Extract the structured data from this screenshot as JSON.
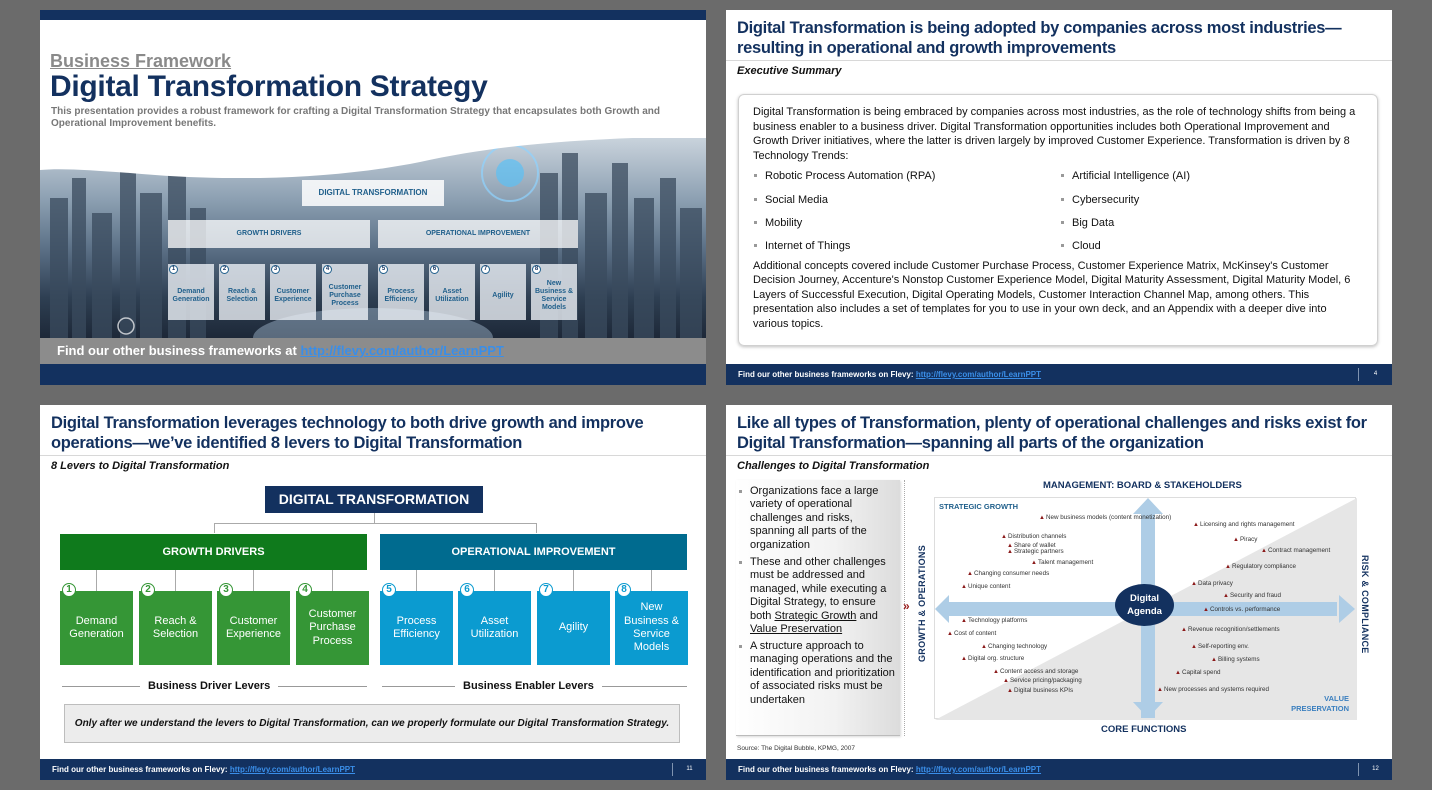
{
  "slides": {
    "cover": {
      "kicker": "Business Framework",
      "title": "Digital Transformation Strategy",
      "description": "This presentation provides a robust framework for crafting a Digital Transformation Strategy that encapsulates both Growth and Operational Improvement benefits.",
      "diagram": {
        "root": "DIGITAL TRANSFORMATION",
        "groups": [
          "GROWTH DRIVERS",
          "OPERATIONAL IMPROVEMENT"
        ],
        "levers": [
          {
            "num": "1",
            "label": "Demand Generation"
          },
          {
            "num": "2",
            "label": "Reach & Selection"
          },
          {
            "num": "3",
            "label": "Customer Experience"
          },
          {
            "num": "4",
            "label": "Customer Purchase Process"
          },
          {
            "num": "5",
            "label": "Process Efficiency"
          },
          {
            "num": "6",
            "label": "Asset Utilization"
          },
          {
            "num": "7",
            "label": "Agility"
          },
          {
            "num": "8",
            "label": "New Business & Service Models"
          }
        ]
      },
      "footer_text": "Find our other business frameworks at",
      "footer_link": "http://flevy.com/author/LearnPPT"
    },
    "summary": {
      "title": "Digital Transformation is being adopted by companies across most industries—resulting in operational and growth improvements",
      "subtitle": "Executive Summary",
      "intro": "Digital Transformation is being embraced by companies across most industries, as the role of technology shifts from being a business enabler to a business driver.  Digital Transformation opportunities includes both Operational Improvement and Growth Driver initiatives, where the latter is driven largely by improved Customer Experience.  Transformation is driven by 8 Technology Trends:",
      "trends": [
        "Robotic Process Automation (RPA)",
        "Artificial Intelligence (AI)",
        "Social Media",
        "Cybersecurity",
        "Mobility",
        "Big Data",
        "Internet of Things",
        "Cloud"
      ],
      "outro": "Additional concepts covered include Customer Purchase Process, Customer Experience Matrix, McKinsey's Customer Decision Journey, Accenture's Nonstop Customer Experience Model, Digital Maturity Assessment, Digital Maturity Model, 6 Layers of Successful Execution, Digital Operating Models, Customer Interaction Channel Map, among others.  This presentation also includes a set of templates for you to use in your own deck, and an Appendix with a deeper dive into various topics.",
      "page": "4"
    },
    "levers": {
      "title": "Digital Transformation leverages technology to both drive growth and improve operations—we’ve identified 8 levers to Digital Transformation",
      "subtitle": "8 Levers to Digital Transformation",
      "root": "DIGITAL TRANSFORMATION",
      "groups": [
        {
          "label": "GROWTH DRIVERS",
          "color": "#0f7a1c"
        },
        {
          "label": "OPERATIONAL IMPROVEMENT",
          "color": "#006b8f"
        }
      ],
      "levers": [
        {
          "num": "1",
          "label": "Demand Generation",
          "color": "#359636"
        },
        {
          "num": "2",
          "label": "Reach & Selection",
          "color": "#359636"
        },
        {
          "num": "3",
          "label": "Customer Experience",
          "color": "#359636"
        },
        {
          "num": "4",
          "label": "Customer Purchase Process",
          "color": "#359636"
        },
        {
          "num": "5",
          "label": "Process Efficiency",
          "color": "#0b9bd0"
        },
        {
          "num": "6",
          "label": "Asset Utilization",
          "color": "#0b9bd0"
        },
        {
          "num": "7",
          "label": "Agility",
          "color": "#0b9bd0"
        },
        {
          "num": "8",
          "label": "New Business & Service Models",
          "color": "#0b9bd0"
        }
      ],
      "left_arrow_label": "Business Driver Levers",
      "right_arrow_label": "Business Enabler Levers",
      "note": "Only after we understand the levers to Digital Transformation, can we properly formulate our Digital Transformation Strategy.",
      "page": "11"
    },
    "challenges": {
      "title": "Like all types of Transformation, plenty of operational challenges and risks exist for Digital Transformation—spanning all parts of the organization",
      "subtitle": "Challenges to Digital Transformation",
      "bullets": [
        "Organizations face a large variety of operational challenges and risks, spanning all parts of the organization",
        "These and other challenges must be addressed and managed, while executing a Digital Strategy, to ensure both",
        "A structure approach to managing operations and the identification and prioritization of associated risks must be undertaken"
      ],
      "bullet2_u1": "Strategic Growth",
      "bullet2_and": "and",
      "bullet2_u2": "Value Preservation",
      "source": "Source: The Digital Bubble, KPMG, 2007",
      "axis_top": "MANAGEMENT: BOARD & STAKEHOLDERS",
      "axis_bottom": "CORE FUNCTIONS",
      "axis_left": "GROWTH & OPERATIONS",
      "axis_right": "RISK & COMPLIANCE",
      "quadrant_tl": "STRATEGIC GROWTH",
      "quadrant_br_1": "VALUE",
      "quadrant_br_2": "PRESERVATION",
      "center_1": "Digital",
      "center_2": "Agenda",
      "items": [
        "New business models (content monetization)",
        "Distribution channels",
        "Share of wallet",
        "Strategic partners",
        "Talent management",
        "Changing consumer needs",
        "Unique content",
        "Licensing and rights management",
        "Piracy",
        "Contract management",
        "Regulatory compliance",
        "Data privacy",
        "Security and fraud",
        "Controls vs. performance",
        "Technology platforms",
        "Cost of content",
        "Changing technology",
        "Digital org. structure",
        "Content access and storage",
        "Service pricing/packaging",
        "Digital business KPIs",
        "Revenue recognition/settlements",
        "Self-reporting env.",
        "Billing systems",
        "Capital spend",
        "New processes and systems required"
      ],
      "page": "12"
    },
    "footer": {
      "text": "Find our other business frameworks on Flevy:",
      "link": "http://flevy.com/author/LearnPPT"
    }
  }
}
